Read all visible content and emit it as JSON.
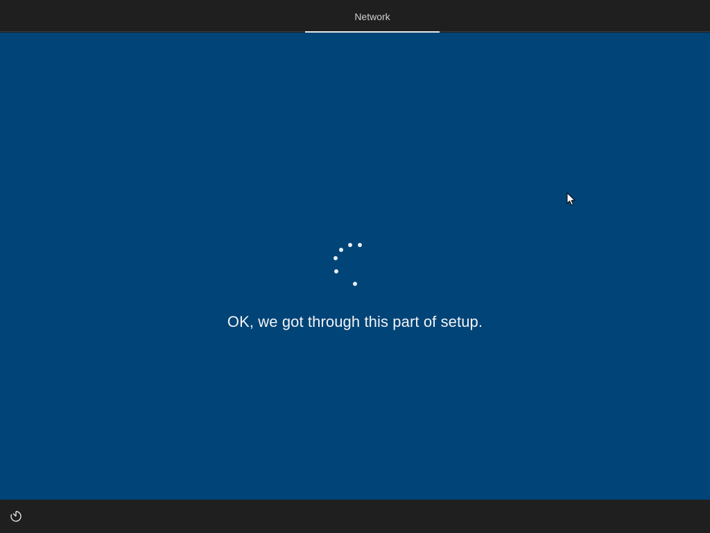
{
  "header": {
    "tab_label": "Network"
  },
  "main": {
    "status_message": "OK, we got through this part of setup."
  },
  "footer": {
    "accessibility_icon": "ease-of-access-icon"
  },
  "colors": {
    "background": "#014477",
    "bars": "#1f1f1f",
    "text": "#f2f4f7",
    "tab_underline": "#e9e9e9"
  }
}
